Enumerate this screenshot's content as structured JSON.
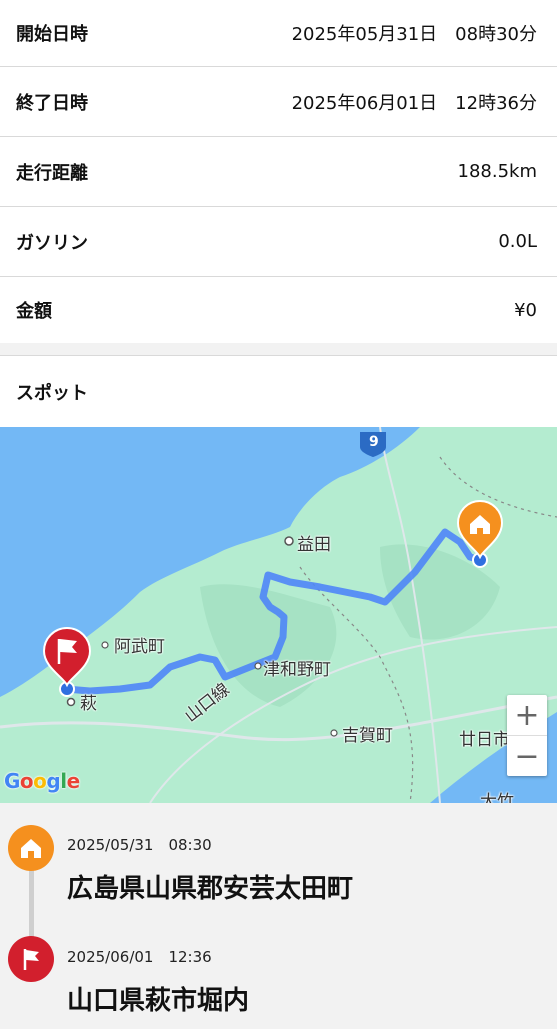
{
  "summary": {
    "start": {
      "label": "開始日時",
      "value": "2025年05月31日　08時30分"
    },
    "end": {
      "label": "終了日時",
      "value": "2025年06月01日　12時36分"
    },
    "distance": {
      "label": "走行距離",
      "value": "188.5km"
    },
    "gasoline": {
      "label": "ガソリン",
      "value": "0.0L"
    },
    "amount": {
      "label": "金額",
      "value": "¥0"
    }
  },
  "spot": {
    "title": "スポット"
  },
  "map": {
    "labels": {
      "masuda": "益田",
      "abu": "阿武町",
      "tsuwano": "津和野町",
      "hagi": "萩",
      "yamaguchi_line": "山口線",
      "yoshika": "吉賀町",
      "hatsukaichi": "廿日市",
      "otake": "大竹",
      "route9": "9"
    },
    "zoom_in": "+",
    "zoom_out": "−",
    "provider": "Google",
    "colors": {
      "route": "#4f86f7",
      "start": "#f5901e",
      "end": "#d21f2d"
    }
  },
  "timeline": [
    {
      "time": "2025/05/31　08:30",
      "address": "広島県山県郡安芸太田町",
      "icon": "home-icon"
    },
    {
      "time": "2025/06/01　12:36",
      "address": "山口県萩市堀内",
      "icon": "flag-icon"
    }
  ]
}
